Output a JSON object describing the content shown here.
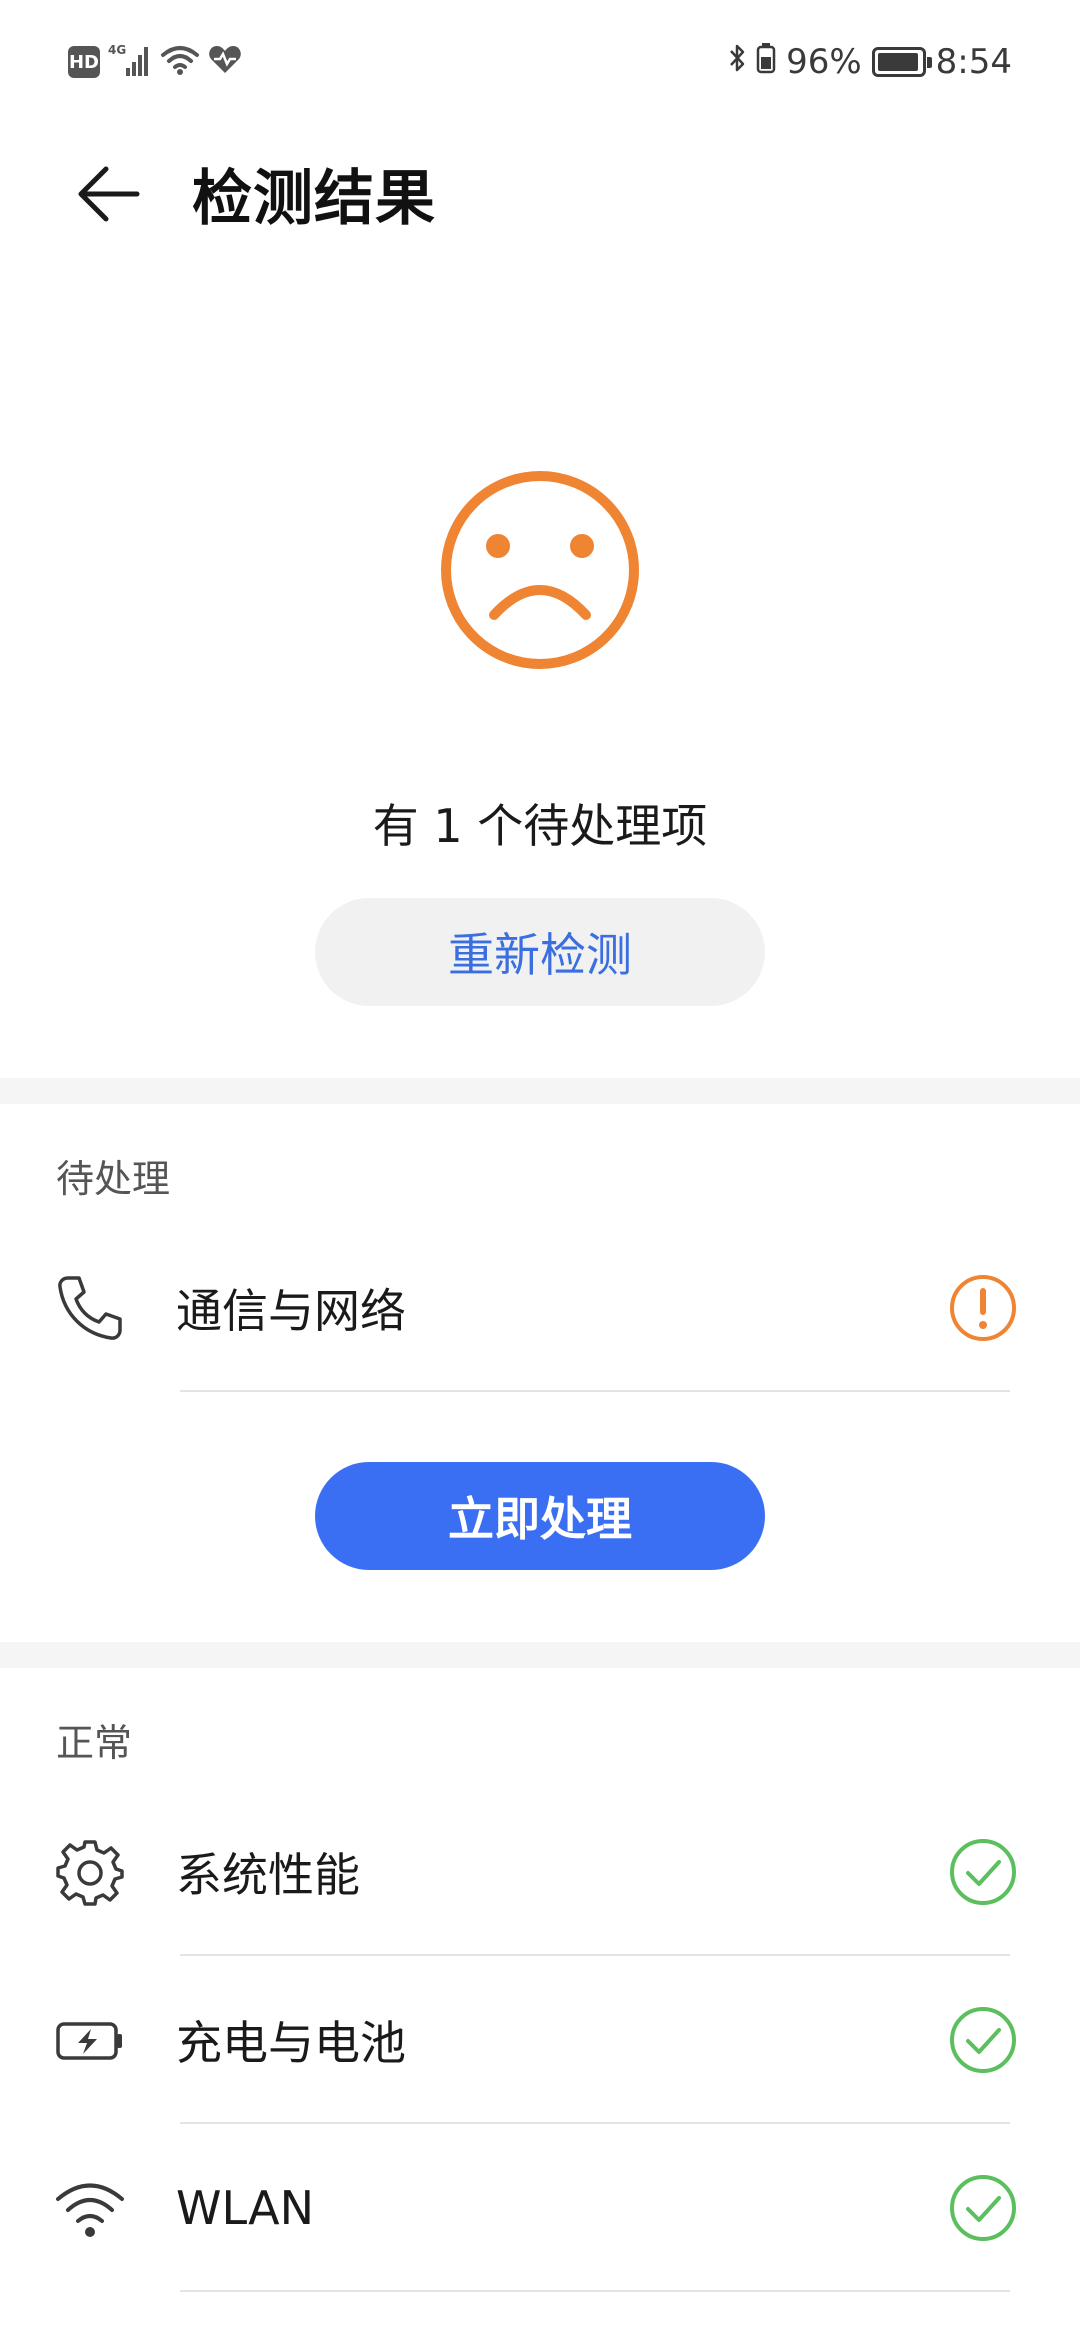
{
  "status_bar": {
    "left_icons": [
      "hd-icon",
      "4g-signal-icon",
      "wifi-icon",
      "health-heart-icon"
    ],
    "hd_label": "HD",
    "battery_percent": "96%",
    "battery_level": 0.96,
    "time": "8:54"
  },
  "header": {
    "back_icon": "arrow-left-icon",
    "title": "检测结果"
  },
  "result": {
    "face_icon": "sad-face-icon",
    "face_color": "#ef8433",
    "summary": "有 1 个待处理项",
    "recheck_label": "重新检测"
  },
  "pending_section": {
    "title": "待处理",
    "items": [
      {
        "label": "通信与网络",
        "icon": "phone-icon",
        "status": "warning",
        "status_icon": "warning-icon"
      }
    ],
    "fix_label": "立即处理"
  },
  "normal_section": {
    "title": "正常",
    "items": [
      {
        "label": "系统性能",
        "icon": "gear-icon",
        "status": "ok",
        "status_icon": "check-icon"
      },
      {
        "label": "充电与电池",
        "icon": "battery-charging-icon",
        "status": "ok",
        "status_icon": "check-icon"
      },
      {
        "label": "WLAN",
        "icon": "wifi-icon",
        "status": "ok",
        "status_icon": "check-icon"
      }
    ]
  },
  "colors": {
    "accent_blue": "#3b6ff3",
    "link_blue": "#3b6fe0",
    "warning_orange": "#ef8433",
    "ok_green": "#5bbf5d"
  }
}
